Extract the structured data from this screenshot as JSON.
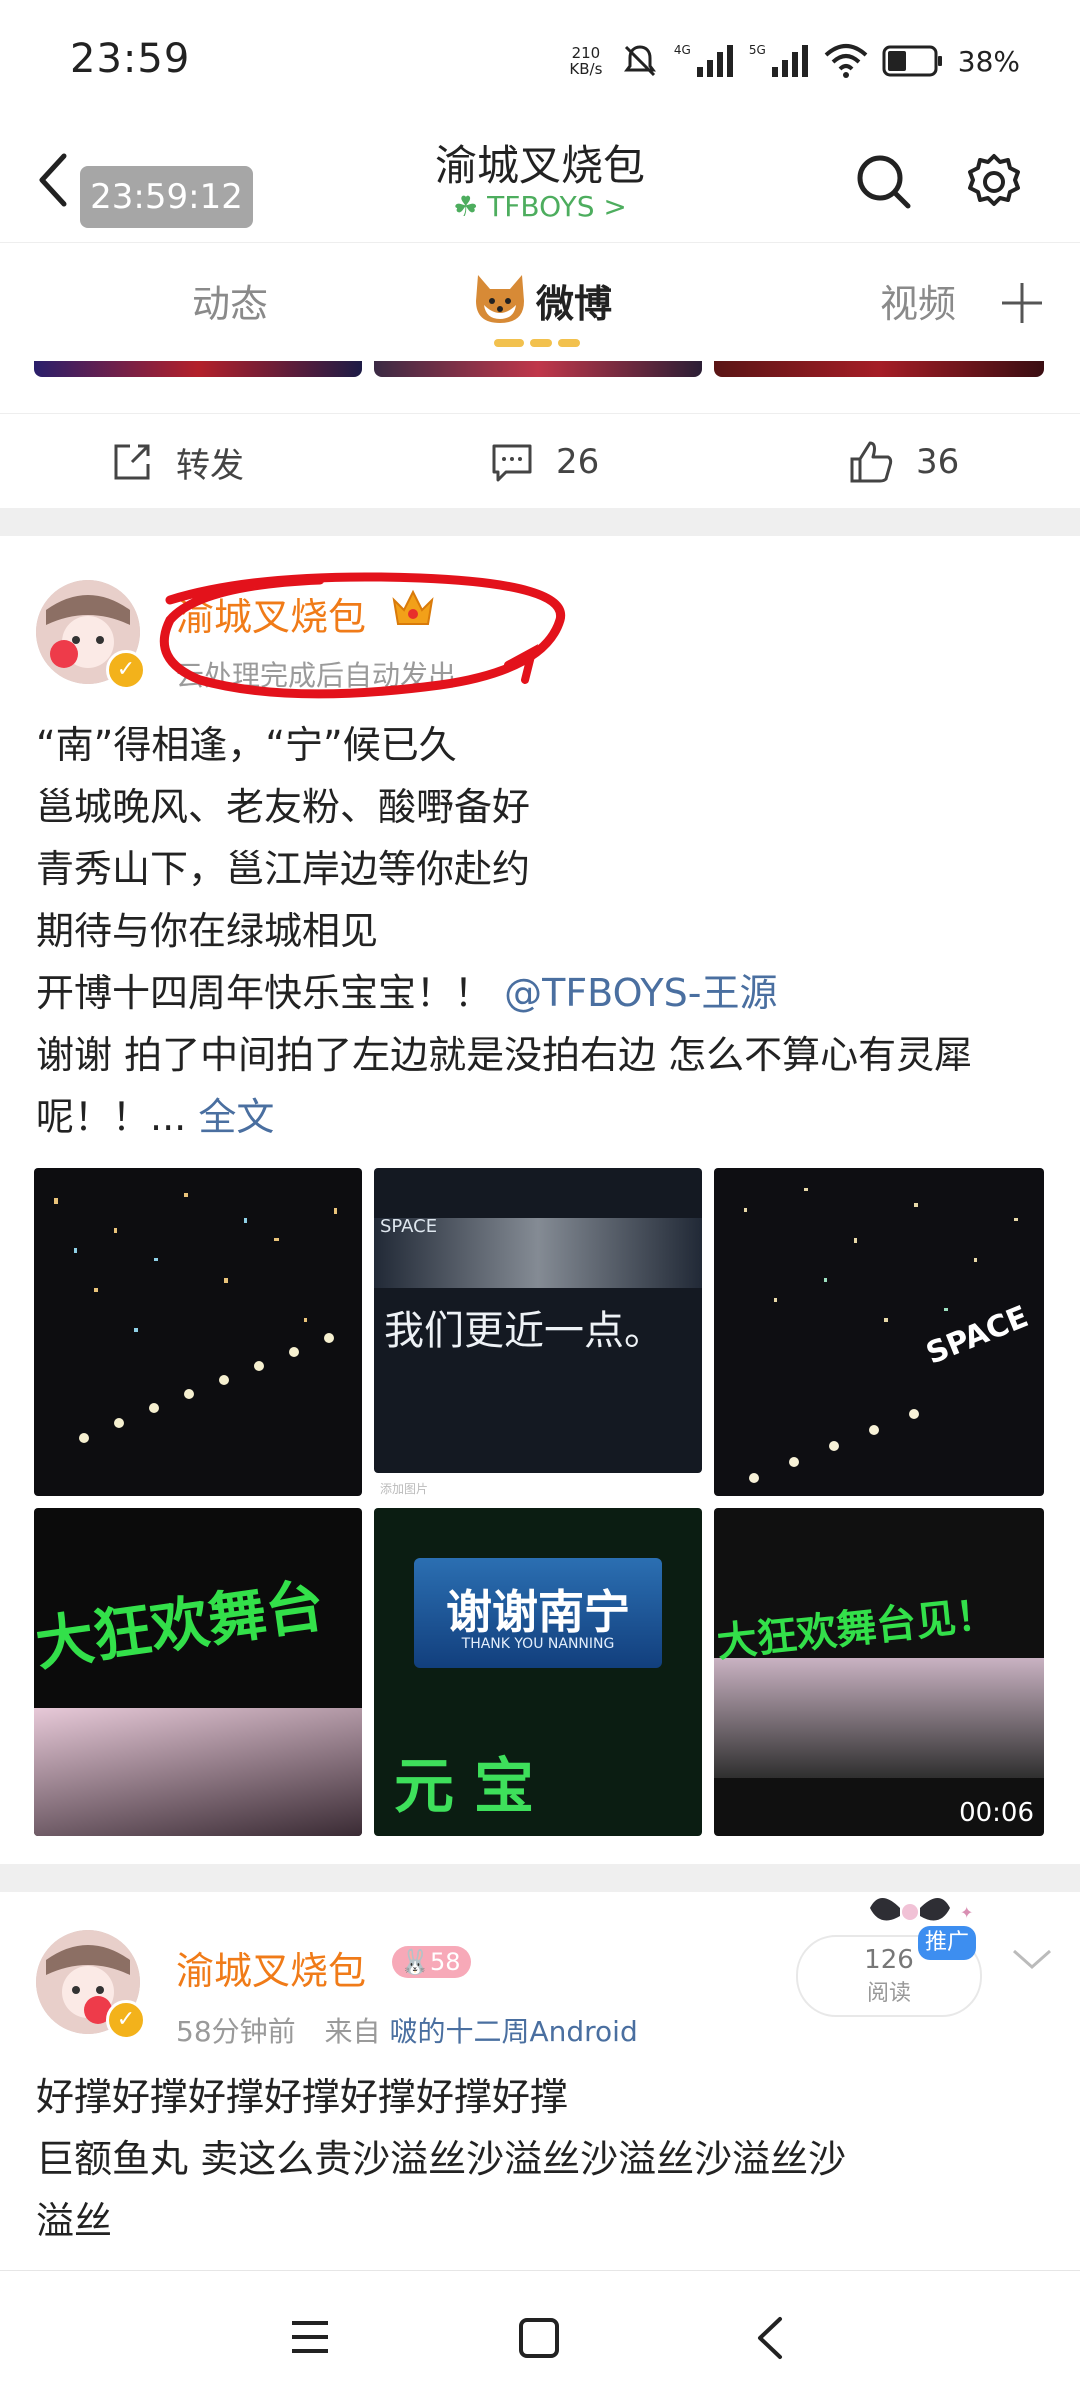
{
  "status_bar": {
    "time": "23:59",
    "net_speed_value": "210",
    "net_speed_unit": "KB/s",
    "net1": "4G",
    "net2": "5G",
    "battery": "38%"
  },
  "header": {
    "overlay_time": "23:59:12",
    "title": "渝城叉烧包",
    "subtitle": "TFBOYS",
    "subtitle_chevron": ">"
  },
  "tabs": [
    {
      "label": "动态",
      "active": false
    },
    {
      "label": "微博",
      "active": true
    },
    {
      "label": "视频",
      "active": false
    }
  ],
  "prev_post_actions": {
    "repost": "转发",
    "comments": "26",
    "likes": "36"
  },
  "post1": {
    "username": "渝城叉烧包",
    "meta": "云处理完成后自动发出",
    "lines": [
      "“南”得相逢，“宁”候已久",
      "邕城晚风、老友粉、酸嘢备好",
      "青秀山下，邕江岸边等你赴约",
      "期待与你在绿城相见"
    ],
    "line5_text": "开博十四周年快乐宝宝！！",
    "mention": "@TFBOYS-王源",
    "line6": "谢谢 拍了中间拍了左边就是没拍右边 怎么不算心有灵犀",
    "line7_text": "呢！！...",
    "full_text": "全文",
    "image_texts": {
      "img2_label": "SPACE",
      "img2_caption": "我们更近一点。",
      "img2_watermark": "添加图片",
      "img3_label": "SPACE",
      "img4_text": "大狂欢舞台",
      "img5_title": "谢谢南宁",
      "img5_sub": "THANK YOU NANNING",
      "img5_light": "元宝",
      "img6_text": "大狂欢舞台见！",
      "video_duration": "00:06"
    }
  },
  "post2": {
    "username": "渝城叉烧包",
    "level": "58",
    "time": "58分钟前",
    "from_prefix": "来自",
    "source": "啵的十二周Android",
    "badge": "推广",
    "reads_count": "126",
    "reads_label": "阅读",
    "line1": "好撑好撑好撑好撑好撑好撑好撑",
    "line2": "巨额鱼丸 卖这么贵沙溢丝沙溢丝沙溢丝沙溢丝沙",
    "line3": "溢丝"
  },
  "colors": {
    "username": "#f07b18",
    "link": "#4a6fa0",
    "green": "#4dad5e",
    "annotation": "#e3121b"
  }
}
